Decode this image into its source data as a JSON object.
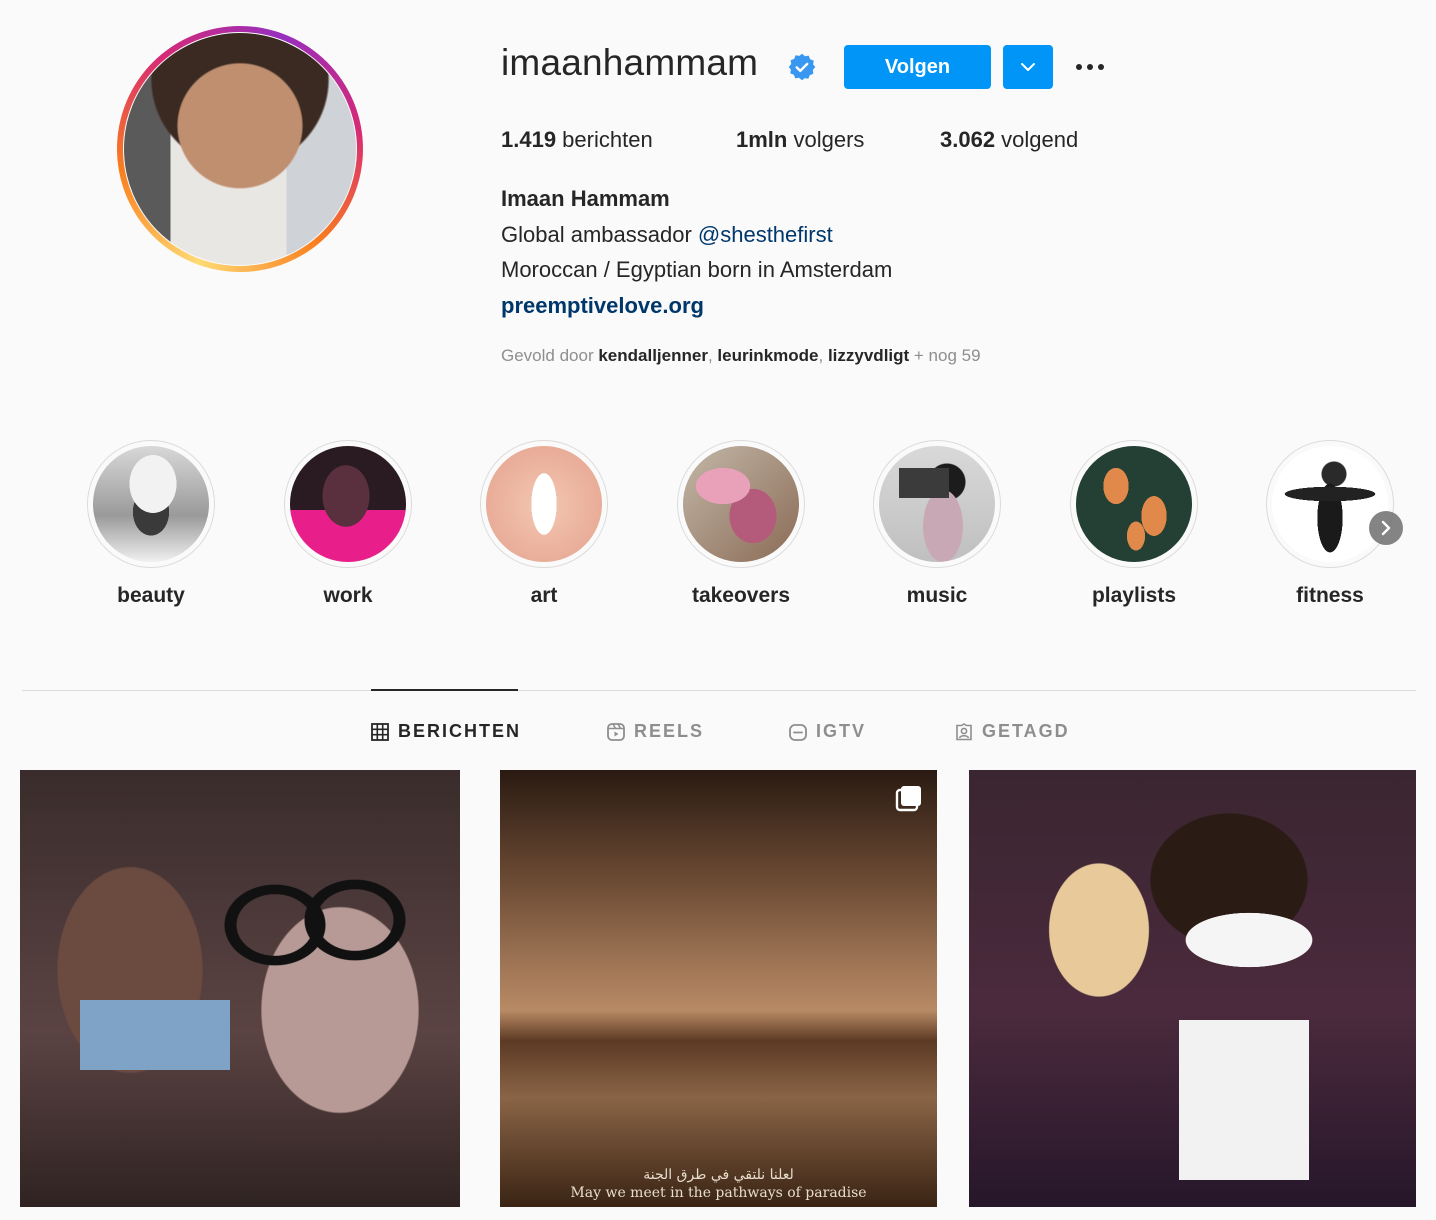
{
  "profile": {
    "username": "imaanhammam",
    "follow_label": "Volgen",
    "stats": {
      "posts_value": "1.419",
      "posts_label": " berichten",
      "followers_value": "1mln",
      "followers_label": " volgers",
      "following_value": "3.062",
      "following_label": " volgend"
    },
    "full_name": "Imaan Hammam",
    "bio_line1_prefix": "Global ambassador ",
    "bio_line1_mention": "@shesthefirst",
    "bio_line2": "Moroccan / Egyptian born in Amsterdam",
    "website": "preemptivelove.org",
    "followed_by_prefix": "Gevold door ",
    "followed_by_users": [
      "kendalljenner",
      "leurinkmode",
      "lizzyvdligt"
    ],
    "followed_by_more": " + nog 59"
  },
  "highlights": [
    {
      "label": "beauty"
    },
    {
      "label": "work"
    },
    {
      "label": "art"
    },
    {
      "label": "takeovers"
    },
    {
      "label": "music"
    },
    {
      "label": "playlists"
    },
    {
      "label": "fitness"
    }
  ],
  "tabs": [
    {
      "label": "BERICHTEN",
      "icon": "grid-icon",
      "active": true
    },
    {
      "label": "REELS",
      "icon": "reels-icon",
      "active": false
    },
    {
      "label": "IGTV",
      "icon": "igtv-icon",
      "active": false
    },
    {
      "label": "GETAGD",
      "icon": "tagged-icon",
      "active": false
    }
  ],
  "posts": [
    {
      "type": "photo"
    },
    {
      "type": "carousel",
      "caption_arabic": "لعلنا نلتقي في طرق الجنة",
      "caption_english": "May we meet in the pathways of paradise"
    },
    {
      "type": "photo"
    }
  ],
  "colors": {
    "accent": "#0095f6",
    "link": "#00376b",
    "text": "#262626",
    "muted": "#8e8e8e",
    "background": "#fafafa",
    "border": "#dbdbdb"
  }
}
